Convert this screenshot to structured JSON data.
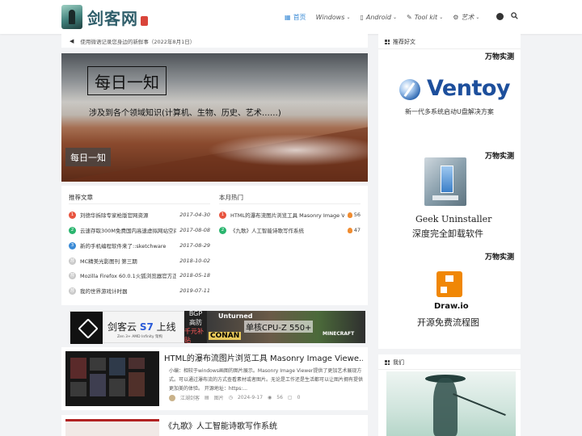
{
  "header": {
    "logo_text": "剑客网",
    "nav": [
      {
        "icon": "home-icon",
        "label": "首页",
        "active": true
      },
      {
        "icon": "",
        "label": "Windows",
        "dropdown": true
      },
      {
        "icon": "",
        "label": "Android",
        "dropdown": true
      },
      {
        "icon": "tool-icon",
        "label": "Tool kit",
        "dropdown": true
      },
      {
        "icon": "art-icon",
        "label": "艺术",
        "dropdown": true
      }
    ]
  },
  "notice": {
    "text": "使用微语记录您身边的新鲜事（2022年8月1日）"
  },
  "hero": {
    "title": "每日一知",
    "subtitle": "涉及到各个领域知识(计算机、生物、历史、艺术……)",
    "tag": "每日一知"
  },
  "recommend": {
    "heading": "推荐文章",
    "items": [
      {
        "rank": "1",
        "title": "刘德华拆除专家枪版官网资源",
        "date": "2017-04-30",
        "color": "#e8543f"
      },
      {
        "rank": "2",
        "title": "云速存取300M免费国内高速虚拟网站空间",
        "date": "2017-08-08",
        "color": "#2ab56e"
      },
      {
        "rank": "3",
        "title": "新的手机编程软件来了::sketchware",
        "date": "2017-08-29",
        "color": "#3b8bd6"
      },
      {
        "rank": "荐",
        "title": "MC精美光影图刊 第三期",
        "date": "2018-10-02",
        "color": "#c9c9c9"
      },
      {
        "rank": "荐",
        "title": "Mozilla Firefox 60.0.1火狐浏览器官方正...",
        "date": "2018-05-18",
        "color": "#c9c9c9"
      },
      {
        "rank": "荐",
        "title": "我的世界游戏计时器",
        "date": "2019-07-11",
        "color": "#c9c9c9"
      }
    ]
  },
  "hot": {
    "heading": "本月热门",
    "items": [
      {
        "rank": "1",
        "title": "HTML的瀑布流图片浏览工具 Masonry Image Vi...",
        "count": "56",
        "color": "#e8543f"
      },
      {
        "rank": "2",
        "title": "《九歌》人工智能诗歌写作系统",
        "count": "47",
        "color": "#2ab56e"
      }
    ]
  },
  "ad": {
    "brand_prefix": "剑客云 ",
    "brand_accent": "S7",
    "brand_suffix": " 上线",
    "note": "Zen 3+ AMD Infinity 架构",
    "mid_line1": "BGP",
    "mid_line2": "高防",
    "mid_line3": "千元补贴",
    "game1": "Unturned",
    "cpu_text": "单核CPU-Z 550+",
    "game2": "CONAN",
    "game3": "MINECRAFT"
  },
  "posts": [
    {
      "title": "HTML的瀑布流图片浏览工具 Masonry Image Viewe...",
      "excerpt": "小编：相较于windows画图的图片展示。Masonry Image Viewer提供了更加艺术展现方式。可以通过瀑布流的方式查看素材或者图片。无论是工作还是生活都可以让图片拥有提供更加美的体验。 开源地址：https:...",
      "author": "江湖剑客",
      "category": "图片",
      "date": "2024-9-17",
      "views": "56",
      "comments": "0"
    },
    {
      "title": "《九歌》人工智能诗歌写作系统"
    }
  ],
  "sidebar": {
    "recommend_heading": "推荐好文",
    "me_heading": "我们",
    "tools": [
      {
        "heading": "万物实测",
        "name": "Ventoy",
        "desc": "新一代多系统启动U盘解决方案"
      },
      {
        "heading": "万物实测",
        "name": "Geek Uninstaller",
        "desc": "深度完全卸载软件"
      },
      {
        "heading": "万物实测",
        "name": "Draw.io",
        "desc": "开源免费流程图"
      }
    ]
  },
  "colors": {
    "accent": "#3b8bd6",
    "brand": "#2f5e6a",
    "ventoy": "#1d4f9c",
    "drawio": "#f08705"
  }
}
